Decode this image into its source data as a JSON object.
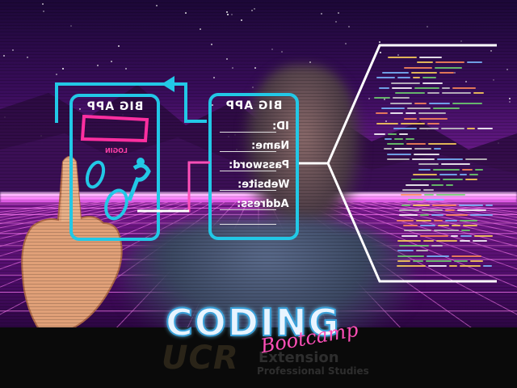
{
  "login_card": {
    "title": "BIG APP",
    "login_label": "LOGIN"
  },
  "form_card": {
    "title": "BIG APP",
    "fields": [
      "ID:",
      "Name:",
      "Password:",
      "Website:",
      "Address:"
    ]
  },
  "logo": {
    "coding": "CODING",
    "bootcamp": "Bootcamp",
    "ucr": "UCR",
    "extension": "Extension",
    "professional": "Professional Studies"
  },
  "colors": {
    "card_outline": "#22c8e6",
    "accent_pink": "#ff3fa8",
    "connector_white": "#ffffff"
  }
}
